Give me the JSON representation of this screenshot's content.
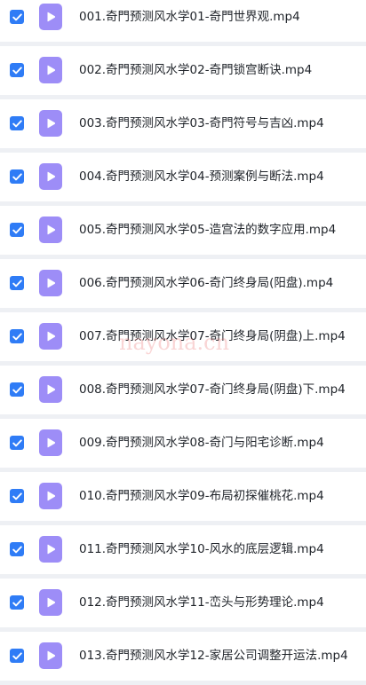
{
  "colors": {
    "checkbox": "#2f7cf6",
    "video_icon": "#9d8df7",
    "row_background": "#ffffff",
    "separator": "#eef0f4",
    "text": "#1f2329"
  },
  "files": [
    {
      "name": "001.奇門预测风水学01-奇門世界观.mp4",
      "checked": true,
      "icon": "video-play-icon"
    },
    {
      "name": "002.奇門预测风水学02-奇門锁宫断诀.mp4",
      "checked": true,
      "icon": "video-play-icon"
    },
    {
      "name": "003.奇門预测风水学03-奇門符号与吉凶.mp4",
      "checked": true,
      "icon": "video-play-icon"
    },
    {
      "name": "004.奇門预测风水学04-预测案例与断法.mp4",
      "checked": true,
      "icon": "video-play-icon"
    },
    {
      "name": "005.奇門预测风水学05-造宫法的数字应用.mp4",
      "checked": true,
      "icon": "video-play-icon"
    },
    {
      "name": "006.奇門预测风水学06-奇门终身局(阳盘).mp4",
      "checked": true,
      "icon": "video-play-icon"
    },
    {
      "name": "007.奇門预测风水学07-奇门终身局(阴盘)上.mp4",
      "checked": true,
      "icon": "video-play-icon"
    },
    {
      "name": "008.奇門预测风水学07-奇门终身局(阴盘)下.mp4",
      "checked": true,
      "icon": "video-play-icon"
    },
    {
      "name": "009.奇門预测风水学08-奇门与阳宅诊断.mp4",
      "checked": true,
      "icon": "video-play-icon"
    },
    {
      "name": "010.奇門预测风水学09-布局初探催桃花.mp4",
      "checked": true,
      "icon": "video-play-icon"
    },
    {
      "name": "011.奇門预测风水学10-风水的底层逻辑.mp4",
      "checked": true,
      "icon": "video-play-icon"
    },
    {
      "name": "012.奇門预测风水学11-峦头与形势理论.mp4",
      "checked": true,
      "icon": "video-play-icon"
    },
    {
      "name": "013.奇門预测风水学12-家居公司调整开运法.mp4",
      "checked": true,
      "icon": "video-play-icon"
    }
  ],
  "watermark": "nayona.cn"
}
